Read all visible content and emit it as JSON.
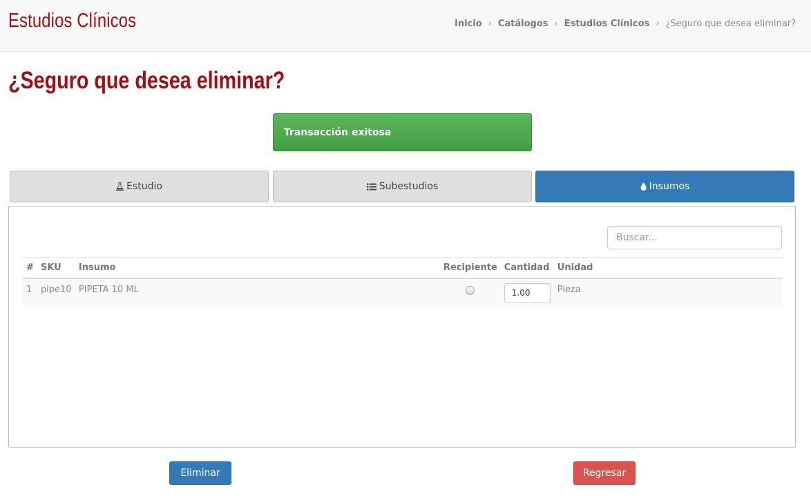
{
  "header": {
    "app_title": "Estudios Clínicos",
    "breadcrumb": [
      {
        "label": "Inicio"
      },
      {
        "label": "Catálogos"
      },
      {
        "label": "Estudios Clínicos"
      },
      {
        "label": "¿Seguro que desea eliminar?"
      }
    ],
    "separator": "›"
  },
  "page_title": "¿Seguro que desea eliminar?",
  "alert": {
    "text": "Transacción exitosa",
    "color": "#5cb85c"
  },
  "tabs": [
    {
      "label": "Estudio",
      "icon": "flask-icon",
      "active": false
    },
    {
      "label": "Subestudios",
      "icon": "list-icon",
      "active": false
    },
    {
      "label": "Insumos",
      "icon": "droplet-icon",
      "active": true
    }
  ],
  "panel": {
    "search": {
      "placeholder": "Buscar...",
      "value": ""
    },
    "table": {
      "columns": [
        "#",
        "SKU",
        "Insumo",
        "Recipiente",
        "Cantidad",
        "Unidad"
      ],
      "rows": [
        {
          "num": "1",
          "sku": "pipe10",
          "insumo": "PIPETA 10 ML",
          "recipiente": false,
          "cantidad": "1.00",
          "unidad": "Pieza"
        }
      ]
    }
  },
  "buttons": {
    "delete_label": "Eliminar",
    "back_label": "Regresar"
  },
  "colors": {
    "brand": "#a10f13",
    "primary": "#337ab7",
    "danger": "#d9534f",
    "success": "#5cb85c"
  }
}
